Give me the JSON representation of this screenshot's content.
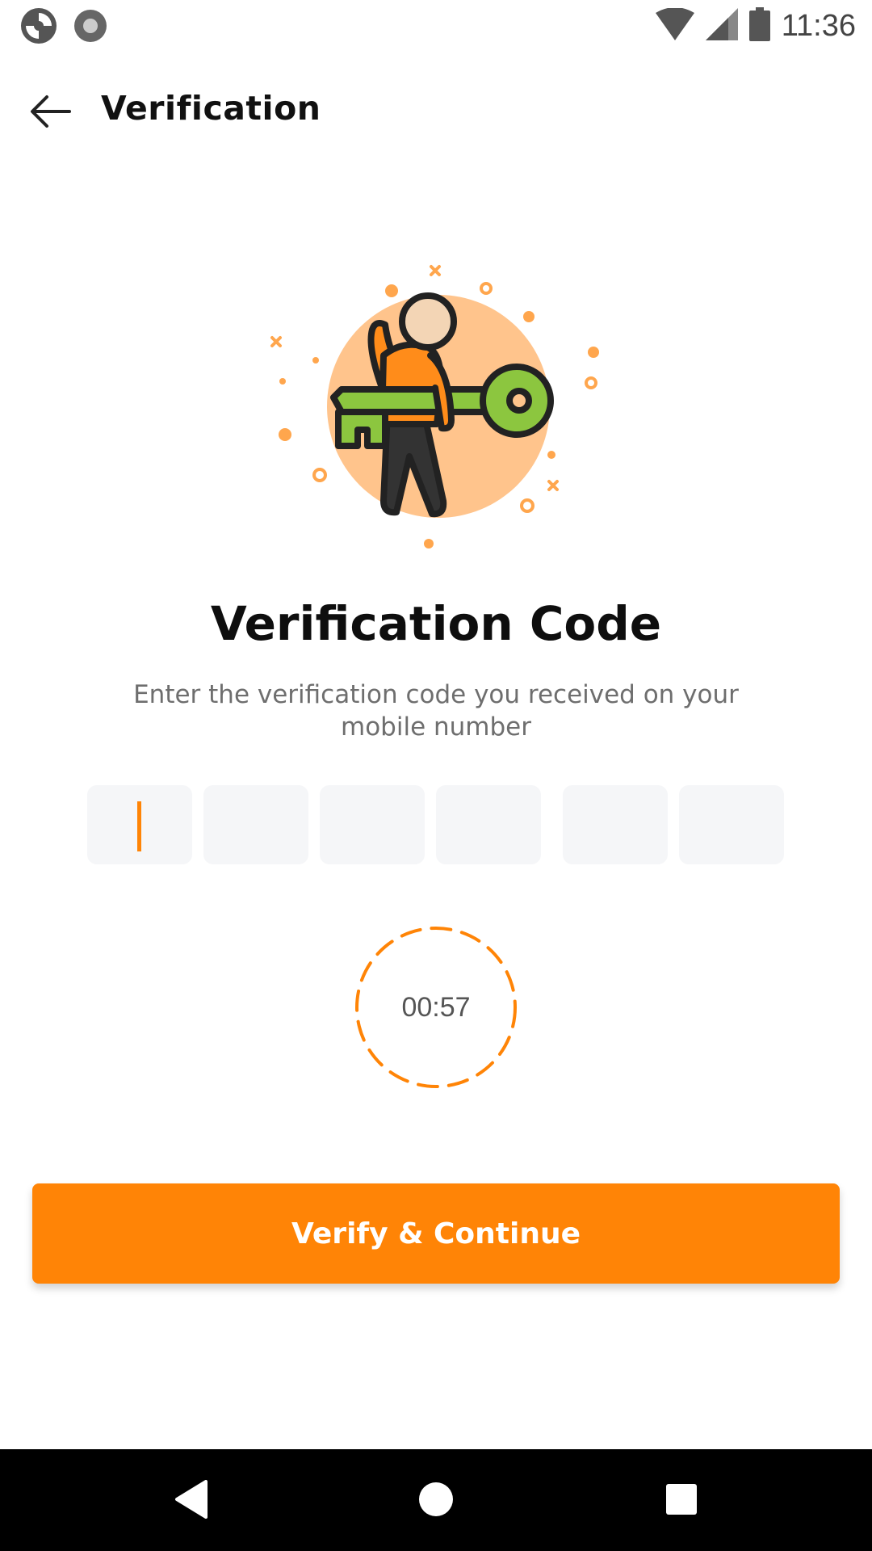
{
  "status_bar": {
    "time": "11:36",
    "icons": [
      "app-sync-icon",
      "record-icon",
      "wifi-icon",
      "signal-icon",
      "battery-icon"
    ]
  },
  "app_bar": {
    "title": "Verification",
    "back_icon": "arrow-left-icon"
  },
  "illustration": {
    "name": "person-holding-key-illustration",
    "colors": {
      "circle": "#ffc48c",
      "key": "#8cc63f",
      "shirt": "#ff8c1a",
      "outline": "#222222"
    }
  },
  "content": {
    "headline": "Verification Code",
    "subtitle": "Enter the verification code you received on your mobile number"
  },
  "otp": {
    "length": 6,
    "values": [
      "",
      "",
      "",
      "",
      "",
      ""
    ],
    "active_index": 0
  },
  "timer": {
    "value": "00:57"
  },
  "actions": {
    "primary_label": "Verify & Continue"
  },
  "nav_bar": {
    "items": [
      "back-triangle-icon",
      "home-circle-icon",
      "recents-square-icon"
    ]
  },
  "colors": {
    "accent": "#ff8406",
    "otp_box_bg": "#f5f6f8",
    "subtitle": "#6e6e6e"
  }
}
